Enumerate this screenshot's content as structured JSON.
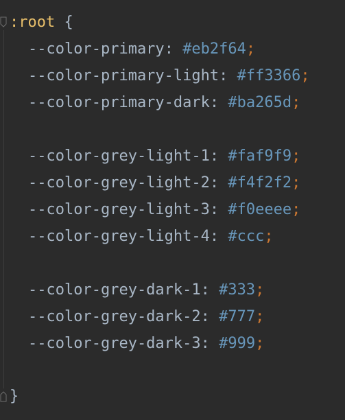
{
  "code": {
    "selector": ":root",
    "open_brace": "{",
    "close_brace": "}",
    "declarations": [
      {
        "name": "--color-primary",
        "value": "#eb2f64"
      },
      {
        "name": "--color-primary-light",
        "value": "#ff3366"
      },
      {
        "name": "--color-primary-dark",
        "value": "#ba265d"
      },
      {
        "name": "--color-grey-light-1",
        "value": "#faf9f9"
      },
      {
        "name": "--color-grey-light-2",
        "value": "#f4f2f2"
      },
      {
        "name": "--color-grey-light-3",
        "value": "#f0eeee"
      },
      {
        "name": "--color-grey-light-4",
        "value": "#ccc"
      },
      {
        "name": "--color-grey-dark-1",
        "value": "#333"
      },
      {
        "name": "--color-grey-dark-2",
        "value": "#777"
      },
      {
        "name": "--color-grey-dark-3",
        "value": "#999"
      }
    ]
  },
  "theme": {
    "background": "#2b2b2b",
    "selector_color": "#e8bf6a",
    "property_color": "#a9b7c6",
    "value_color": "#6897bb",
    "punctuation_color": "#cc7832"
  },
  "icons": {
    "fold_start": "fold-collapse-icon",
    "fold_end": "fold-end-icon"
  }
}
